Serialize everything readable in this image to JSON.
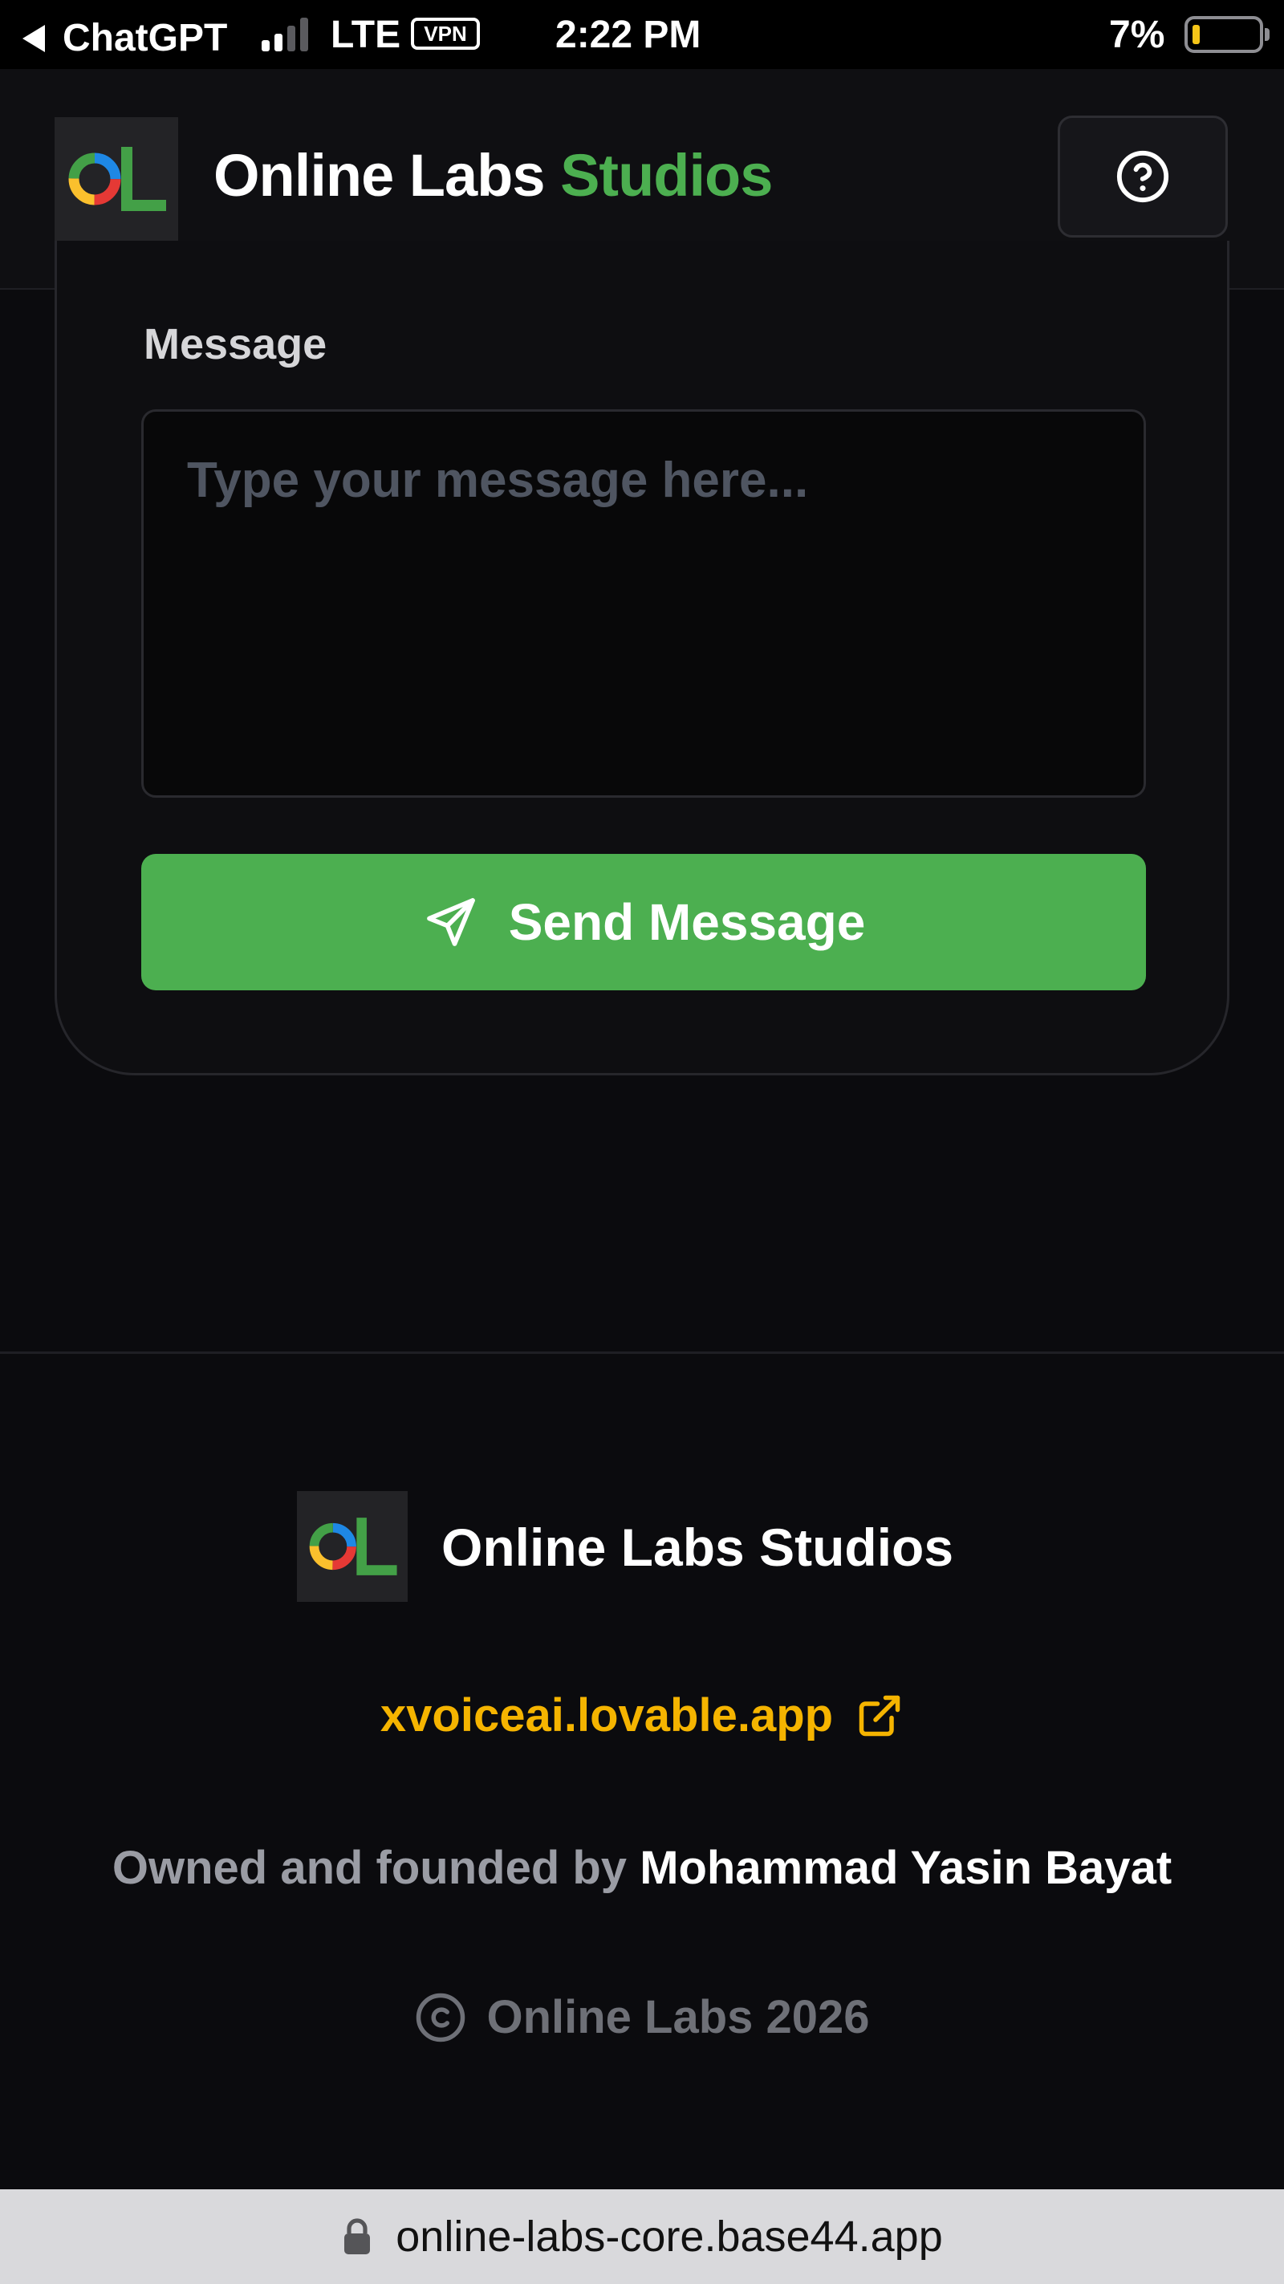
{
  "status_bar": {
    "back_app": "ChatGPT",
    "network": "LTE",
    "vpn": "VPN",
    "time": "2:22 PM",
    "battery_percent": "7%",
    "battery_level": 0.07,
    "signal_bars_active": 2,
    "signal_bars_total": 4
  },
  "header": {
    "brand_primary": "Online Labs",
    "brand_accent": "Studios",
    "logo_text": "OL",
    "help_icon": "help-circle-icon"
  },
  "form": {
    "message_label": "Message",
    "message_placeholder": "Type your message here...",
    "message_value": "",
    "send_label": "Send Message",
    "send_icon": "send-icon"
  },
  "footer": {
    "brand": "Online Labs Studios",
    "link_text": "xvoiceai.lovable.app",
    "link_icon": "external-link-icon",
    "owner_prefix": "Owned and founded by",
    "owner_name": "Mohammad Yasin Bayat",
    "copyright_text": "Online Labs 2026",
    "copyright_icon": "copyright-icon"
  },
  "browser": {
    "url": "online-labs-core.base44.app",
    "lock_icon": "lock-icon"
  },
  "colors": {
    "accent_green": "#4caf50",
    "link_yellow": "#f5b400",
    "background": "#0b0b0e",
    "logo_blue": "#1e88e5",
    "logo_red": "#e53935",
    "logo_yellow": "#fbc02d",
    "logo_green": "#43a047"
  }
}
